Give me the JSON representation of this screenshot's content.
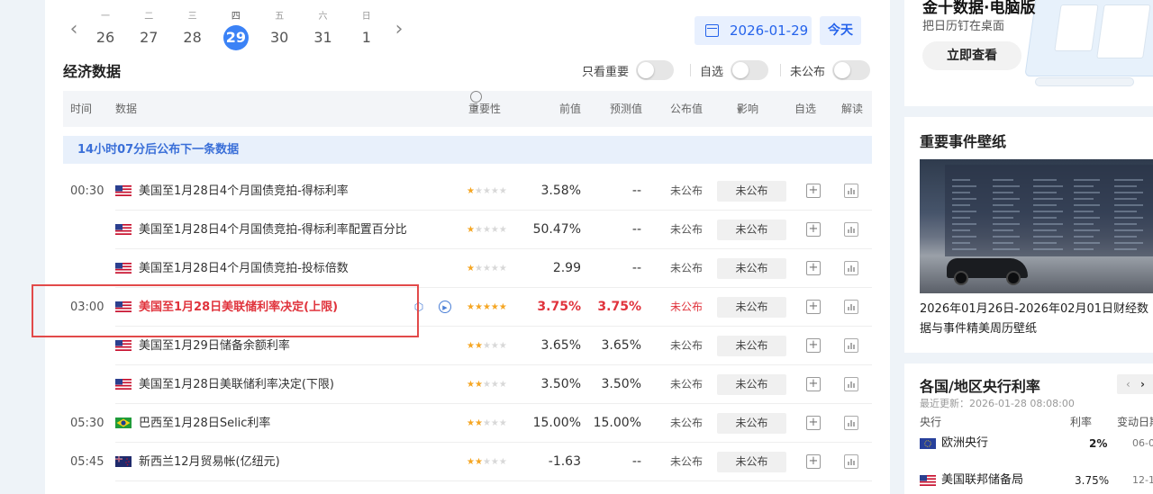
{
  "calendar": {
    "prev_arrow": "‹",
    "next_arrow": "›",
    "days": [
      {
        "weekday": "一",
        "date": "26"
      },
      {
        "weekday": "二",
        "date": "27"
      },
      {
        "weekday": "三",
        "date": "28"
      },
      {
        "weekday": "四",
        "date": "29",
        "active": true
      },
      {
        "weekday": "五",
        "date": "30"
      },
      {
        "weekday": "六",
        "date": "31"
      },
      {
        "weekday": "日",
        "date": "1"
      }
    ],
    "selected_date": "2026-01-29",
    "today_label": "今天"
  },
  "section": {
    "title": "经济数据",
    "filters": [
      "只看重要",
      "自选",
      "未公布"
    ]
  },
  "table": {
    "headers": {
      "time": "时间",
      "data": "数据",
      "importance": "重要性",
      "previous": "前值",
      "forecast": "预测值",
      "actual": "公布值",
      "impact": "影响",
      "watch": "自选",
      "interpret": "解读"
    },
    "notice": "14小时07分后公布下一条数据",
    "rows": [
      {
        "time": "00:30",
        "flag": "us",
        "name": "美国至1月28日4个月国债竞拍-得标利率",
        "stars": 1,
        "previous": "3.58%",
        "forecast": "--",
        "actual": "未公布",
        "impact": "未公布"
      },
      {
        "time": "",
        "flag": "us",
        "name": "美国至1月28日4个月国债竞拍-得标利率配置百分比",
        "stars": 1,
        "previous": "50.47%",
        "forecast": "--",
        "actual": "未公布",
        "impact": "未公布"
      },
      {
        "time": "",
        "flag": "us",
        "name": "美国至1月28日4个月国债竞拍-投标倍数",
        "stars": 1,
        "previous": "2.99",
        "forecast": "--",
        "actual": "未公布",
        "impact": "未公布"
      },
      {
        "time": "03:00",
        "flag": "us",
        "name": "美国至1月28日美联储利率决定(上限)",
        "stars": 5,
        "previous": "3.75%",
        "forecast": "3.75%",
        "actual": "未公布",
        "impact": "未公布",
        "hot": true
      },
      {
        "time": "",
        "flag": "us",
        "name": "美国至1月29日储备余额利率",
        "stars": 2,
        "previous": "3.65%",
        "forecast": "3.65%",
        "actual": "未公布",
        "impact": "未公布"
      },
      {
        "time": "",
        "flag": "us",
        "name": "美国至1月28日美联储利率决定(下限)",
        "stars": 2,
        "previous": "3.50%",
        "forecast": "3.50%",
        "actual": "未公布",
        "impact": "未公布"
      },
      {
        "time": "05:30",
        "flag": "br",
        "name": "巴西至1月28日Selic利率",
        "stars": 2,
        "previous": "15.00%",
        "forecast": "15.00%",
        "actual": "未公布",
        "impact": "未公布"
      },
      {
        "time": "05:45",
        "flag": "nz",
        "name": "新西兰12月贸易帐(亿纽元)",
        "stars": 2,
        "previous": "-1.63",
        "forecast": "--",
        "actual": "未公布",
        "impact": "未公布"
      }
    ]
  },
  "promo": {
    "title": "金十数据·电脑版",
    "subtitle": "把日历钉在桌面",
    "button": "立即查看"
  },
  "wallpaper": {
    "title": "重要事件壁纸",
    "caption": "2026年01月26日-2026年02月01日财经数据与事件精美周历壁纸"
  },
  "rates": {
    "title": "各国/地区央行利率",
    "updated": "最近更新：2026-01-28 08:08:00",
    "headers": {
      "bank": "央行",
      "rate": "利率",
      "date": "变动日期"
    },
    "rows": [
      {
        "flag": "eu",
        "name": "欧洲央行",
        "rate": "2%",
        "date": "06-0"
      },
      {
        "flag": "us",
        "name": "美国联邦储备局",
        "rate": "3.75%",
        "date": "12-1"
      }
    ]
  },
  "colors": {
    "accent": "#2563eb",
    "hot": "#e0333c",
    "star": "#f5a623",
    "highlight_box": "#e24a4a"
  }
}
